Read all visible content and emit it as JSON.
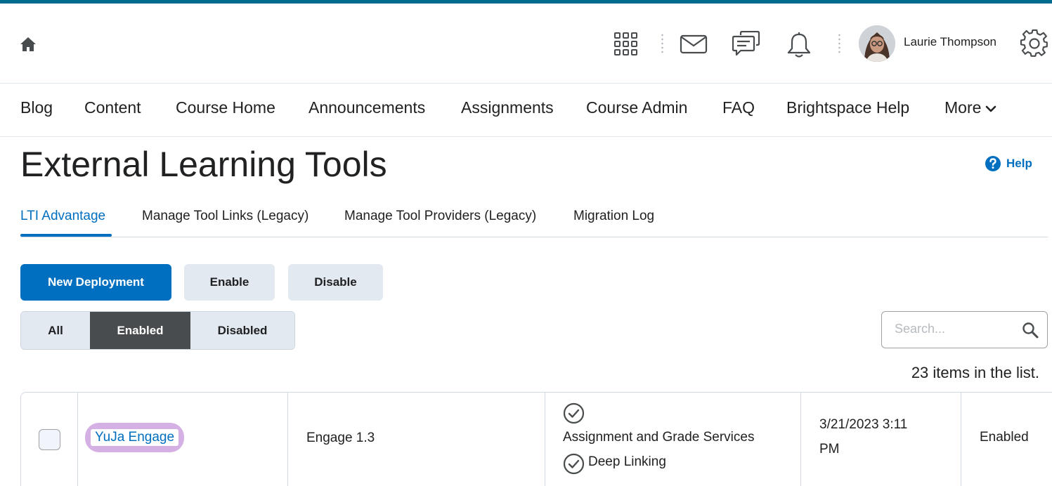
{
  "header": {
    "user_name": "Laurie Thompson"
  },
  "nav": {
    "items": [
      "Blog",
      "Content",
      "Course Home",
      "Announcements",
      "Assignments",
      "Course Admin",
      "FAQ",
      "Brightspace Help"
    ],
    "more_label": "More"
  },
  "page": {
    "title": "External Learning Tools",
    "help_label": "Help"
  },
  "tabs": [
    "LTI Advantage",
    "Manage Tool Links (Legacy)",
    "Manage Tool Providers (Legacy)",
    "Migration Log"
  ],
  "toolbar": {
    "new_deployment": "New Deployment",
    "enable": "Enable",
    "disable": "Disable"
  },
  "filter": {
    "options": [
      "All",
      "Enabled",
      "Disabled"
    ],
    "selected": "Enabled"
  },
  "search": {
    "placeholder": "Search..."
  },
  "list": {
    "count_text": "23 items in the list.",
    "rows": [
      {
        "name": "YuJa Engage",
        "version": "Engage 1.3",
        "service_1": "Assignment and Grade Services",
        "service_2": "Deep Linking",
        "date_line_1": "3/21/2023 3:11",
        "date_line_2": "PM",
        "status": "Enabled"
      }
    ]
  },
  "colors": {
    "accent": "#006fbf",
    "top_bar": "#006b8f",
    "highlight": "#d4b0e4",
    "selected_filter": "#494c4e"
  }
}
